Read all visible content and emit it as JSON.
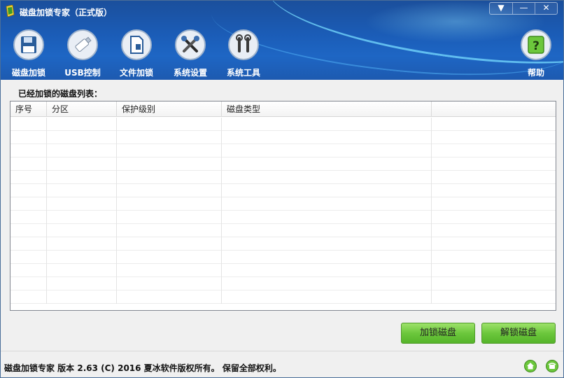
{
  "window": {
    "title": "磁盘加锁专家（正式版）",
    "system_buttons": {
      "menu": "▼",
      "minimize": "—",
      "close": "✕"
    }
  },
  "toolbar": {
    "items": [
      {
        "label": "磁盘加锁",
        "icon": "disk-lock-icon"
      },
      {
        "label": "USB控制",
        "icon": "usb-drive-icon"
      },
      {
        "label": "文件加锁",
        "icon": "file-lock-icon"
      },
      {
        "label": "系统设置",
        "icon": "tools-settings-icon"
      },
      {
        "label": "系统工具",
        "icon": "wrench-icon"
      }
    ],
    "help": {
      "label": "帮助",
      "icon": "help-icon"
    }
  },
  "main": {
    "list_title": "已经加锁的磁盘列表：",
    "table": {
      "columns": [
        "序号",
        "分区",
        "保护级别",
        "磁盘类型",
        ""
      ],
      "rows": []
    },
    "buttons": {
      "lock": "加锁磁盘",
      "unlock": "解锁磁盘"
    }
  },
  "status_bar": {
    "text": "磁盘加锁专家 版本 2.63 (C) 2016 夏冰软件版权所有。 保留全部权利。",
    "icons": [
      "home-icon",
      "phone-icon"
    ]
  },
  "colors": {
    "header_blue": "#1b5db8",
    "accent_green": "#6cc73c",
    "button_border": "#4f9a2a"
  }
}
